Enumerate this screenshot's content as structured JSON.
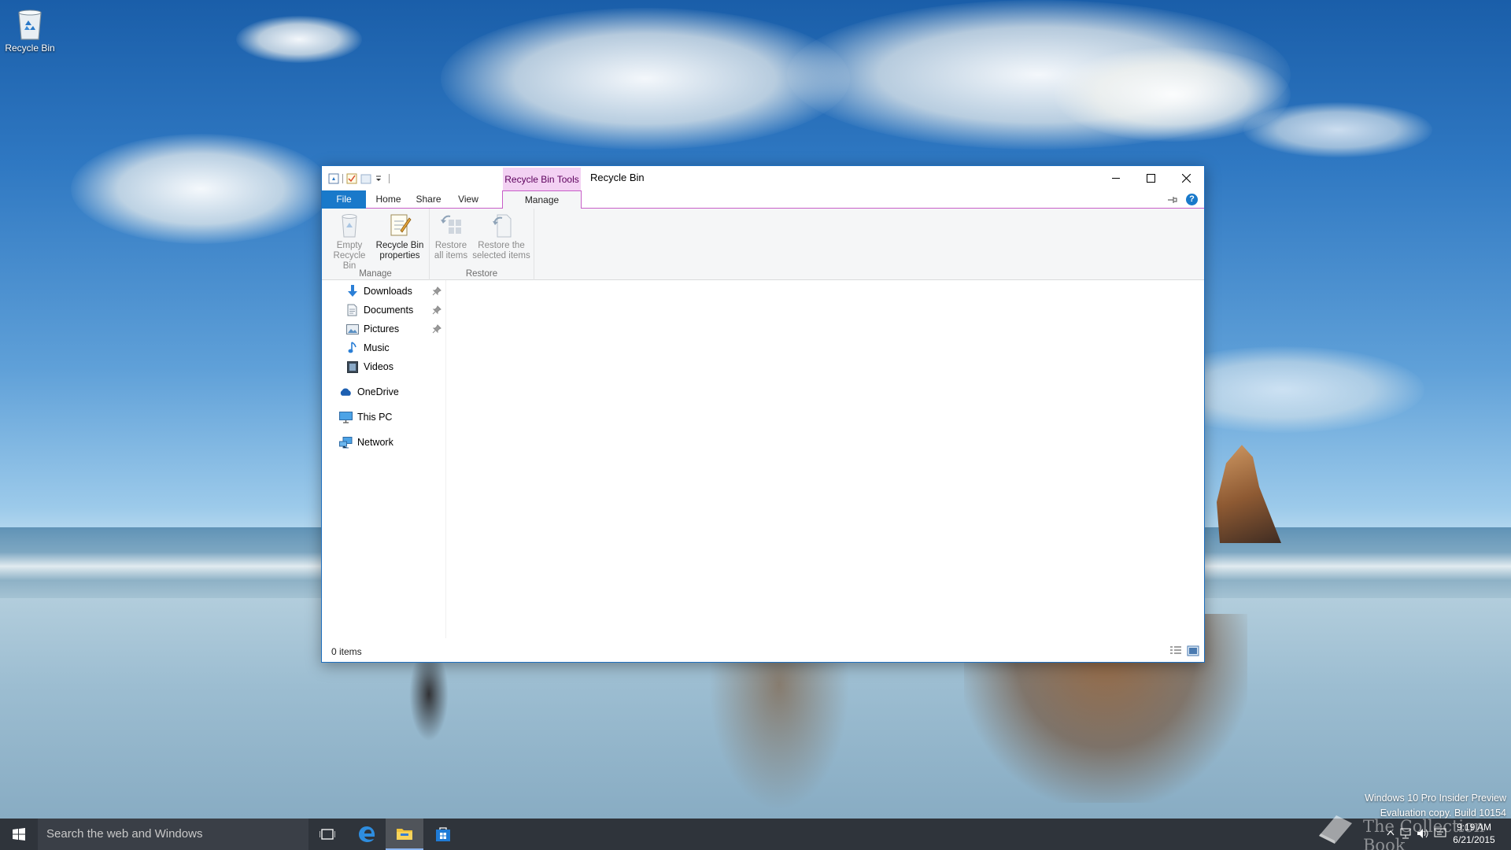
{
  "desktop": {
    "icons": [
      {
        "label": "Recycle Bin",
        "icon": "recycle-bin-icon"
      }
    ],
    "watermark": {
      "line1": "Windows 10 Pro Insider Preview",
      "line2": "Evaluation copy. Build 10154"
    },
    "logo_text": "The Collection Book"
  },
  "window": {
    "title": "Recycle Bin",
    "context_tab": "Recycle Bin Tools",
    "tabs": [
      {
        "label": "File"
      },
      {
        "label": "Home"
      },
      {
        "label": "Share"
      },
      {
        "label": "View"
      },
      {
        "label": "Manage"
      }
    ],
    "ribbon": {
      "groups": [
        {
          "label": "Manage",
          "buttons": [
            {
              "line1": "Empty",
              "line2": "Recycle Bin",
              "icon": "empty-recycle-bin-icon",
              "enabled": false
            },
            {
              "line1": "Recycle Bin",
              "line2": "properties",
              "icon": "properties-icon",
              "enabled": true
            }
          ]
        },
        {
          "label": "Restore",
          "buttons": [
            {
              "line1": "Restore",
              "line2": "all items",
              "icon": "restore-all-icon",
              "enabled": false
            },
            {
              "line1": "Restore the",
              "line2": "selected items",
              "icon": "restore-selected-icon",
              "enabled": false
            }
          ]
        }
      ]
    },
    "nav": [
      {
        "label": "Downloads",
        "icon": "downloads-icon",
        "pinned": true
      },
      {
        "label": "Documents",
        "icon": "documents-icon",
        "pinned": true
      },
      {
        "label": "Pictures",
        "icon": "pictures-icon",
        "pinned": true
      },
      {
        "label": "Music",
        "icon": "music-icon",
        "pinned": false
      },
      {
        "label": "Videos",
        "icon": "videos-icon",
        "pinned": false
      },
      {
        "label": "OneDrive",
        "icon": "onedrive-icon",
        "pinned": false
      },
      {
        "label": "This PC",
        "icon": "this-pc-icon",
        "pinned": false
      },
      {
        "label": "Network",
        "icon": "network-icon",
        "pinned": false
      }
    ],
    "status": {
      "items": "0 items"
    }
  },
  "taskbar": {
    "search_placeholder": "Search the web and Windows",
    "apps": [
      "task-view-icon",
      "edge-icon",
      "file-explorer-icon",
      "store-icon"
    ],
    "clock": {
      "time": "9:19 AM",
      "date": "6/21/2015"
    }
  },
  "colors": {
    "accent": "#1979ca",
    "context_tab": "#f3d1f3",
    "context_border": "#c85ec8",
    "taskbar": "#121820"
  }
}
